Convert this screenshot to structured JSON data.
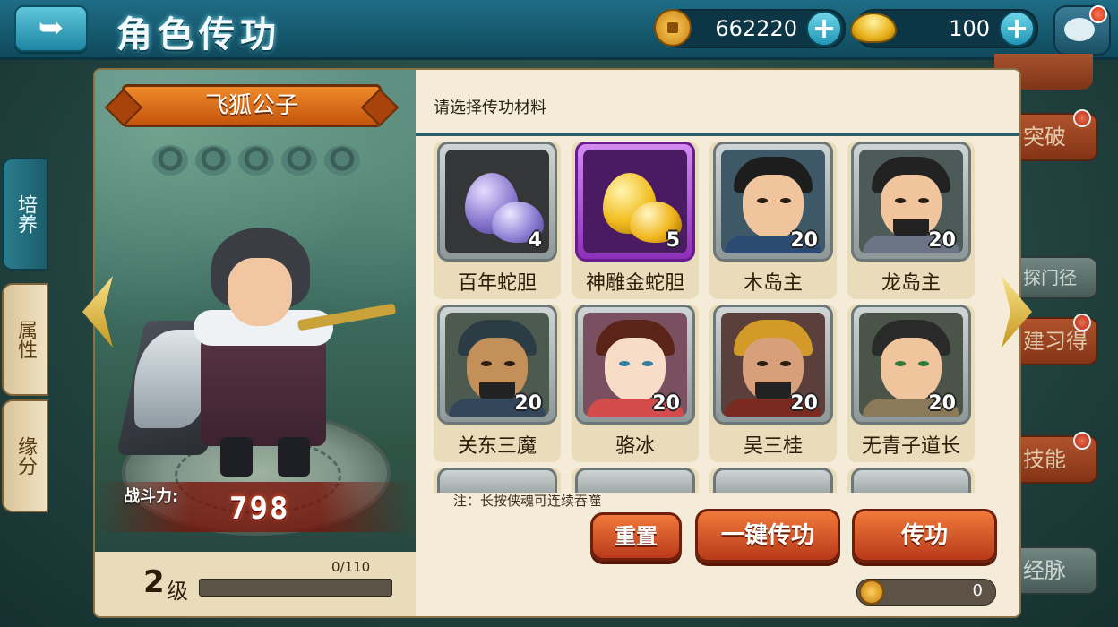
{
  "header": {
    "title": "角色传功",
    "coins": "662220",
    "gold": "100",
    "icons": [
      "back-arrow-icon",
      "copper-coin-icon",
      "gold-ingot-icon",
      "plus-icon",
      "chat-icon"
    ]
  },
  "side_tabs": [
    {
      "label": "培养",
      "active": true
    },
    {
      "label": "属性",
      "active": false
    },
    {
      "label": "缘分",
      "active": false
    }
  ],
  "right_menu": [
    "突破",
    "探门径",
    "建习得",
    "技能",
    "经脉"
  ],
  "hero": {
    "name": "飞狐公子",
    "power_label": "战斗力:",
    "power": "798",
    "level": "2",
    "level_unit": "级",
    "exp_text": "0/110",
    "exp_progress": 0
  },
  "materials": {
    "title": "请选择传功材料",
    "items": [
      {
        "name": "百年蛇胆",
        "count": "4",
        "kind": "egg-purple"
      },
      {
        "name": "神雕金蛇胆",
        "count": "5",
        "kind": "egg-gold"
      },
      {
        "name": "木岛主",
        "count": "20",
        "kind": "portrait"
      },
      {
        "name": "龙岛主",
        "count": "20",
        "kind": "portrait"
      },
      {
        "name": "关东三魔",
        "count": "20",
        "kind": "portrait"
      },
      {
        "name": "骆冰",
        "count": "20",
        "kind": "portrait"
      },
      {
        "name": "吴三桂",
        "count": "20",
        "kind": "portrait"
      },
      {
        "name": "无青子道长",
        "count": "20",
        "kind": "portrait"
      }
    ],
    "note": "注：长按侠魂可连续吞噬"
  },
  "actions": {
    "reset": "重置",
    "one_key": "一键传功",
    "pass": "传功",
    "cost": "0"
  },
  "colors": {
    "accent_orange": "#e06a2c",
    "teal": "#1f6d86",
    "exp_fill": "#ffb23a",
    "purple_frame": "#8d2fb8"
  }
}
